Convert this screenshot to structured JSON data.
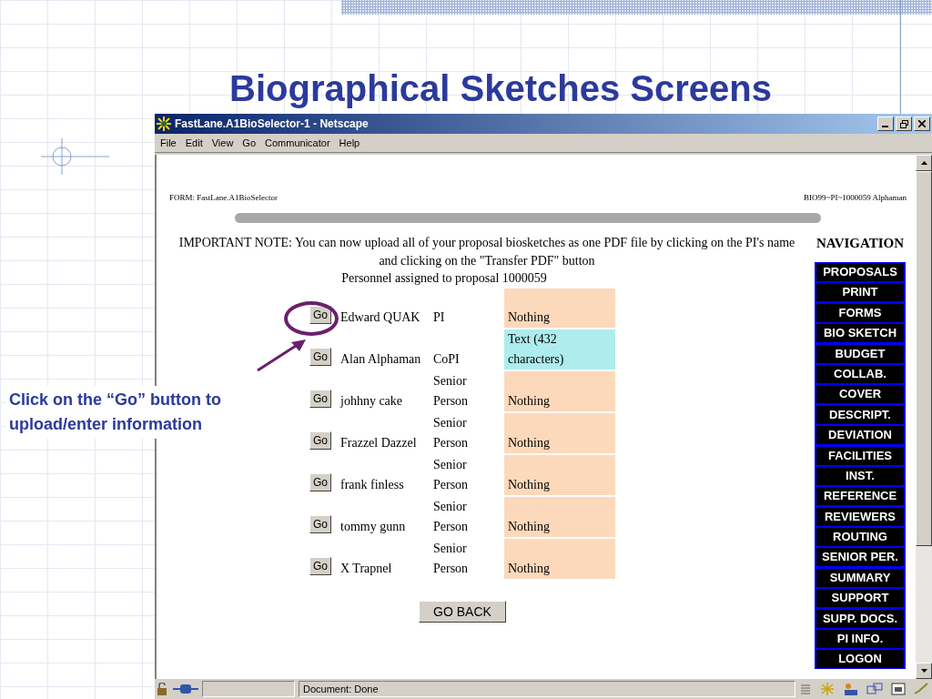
{
  "slide": {
    "title": "Biographical Sketches Screens",
    "callout": "Click on the “Go” button to upload/enter information"
  },
  "window": {
    "title": "FastLane.A1BioSelector-1 - Netscape"
  },
  "menu": [
    "File",
    "Edit",
    "View",
    "Go",
    "Communicator",
    "Help"
  ],
  "form_label": "FORM: FastLane.A1BioSelector",
  "proposal_id": "BIO99~PI~1000059 Alphaman",
  "note": "IMPORTANT NOTE: You can now upload all of your proposal biosketches as one PDF file by clicking on the PI's name and clicking on the \"Transfer PDF\" button",
  "caption": "Personnel assigned to proposal 1000059",
  "rows": [
    {
      "button": "Go",
      "name": "Edward QUAK",
      "role": "PI",
      "status": "Nothing",
      "color": "#fcd9bb",
      "highlighted": true
    },
    {
      "button": "Go",
      "name": "Alan Alphaman",
      "role": "CoPI",
      "status": "Text (432 characters)",
      "color": "#aeeced",
      "highlighted": false
    },
    {
      "button": "Go",
      "name": "johhny cake",
      "role": "Senior Person",
      "status": "Nothing",
      "color": "#fcd9bb",
      "highlighted": false
    },
    {
      "button": "Go",
      "name": "Frazzel Dazzel",
      "role": "Senior Person",
      "status": "Nothing",
      "color": "#fcd9bb",
      "highlighted": false
    },
    {
      "button": "Go",
      "name": "frank finless",
      "role": "Senior Person",
      "status": "Nothing",
      "color": "#fcd9bb",
      "highlighted": false
    },
    {
      "button": "Go",
      "name": "tommy gunn",
      "role": "Senior Person",
      "status": "Nothing",
      "color": "#fcd9bb",
      "highlighted": false
    },
    {
      "button": "Go",
      "name": "X Trapnel",
      "role": "Senior Person",
      "status": "Nothing",
      "color": "#fcd9bb",
      "highlighted": false
    }
  ],
  "go_back": "GO BACK",
  "navigation": {
    "title": "NAVIGATION",
    "items": [
      "PROPOSALS",
      "PRINT",
      "FORMS",
      "BIO SKETCH",
      "BUDGET",
      "COLLAB.",
      "COVER",
      "DESCRIPT.",
      "DEVIATION",
      "FACILITIES",
      "INST.",
      "REFERENCE",
      "REVIEWERS",
      "ROUTING",
      "SENIOR PER.",
      "SUMMARY",
      "SUPPORT",
      "SUPP. DOCS.",
      "PI INFO.",
      "LOGON"
    ]
  },
  "status_bar": {
    "text": "Document: Done"
  }
}
